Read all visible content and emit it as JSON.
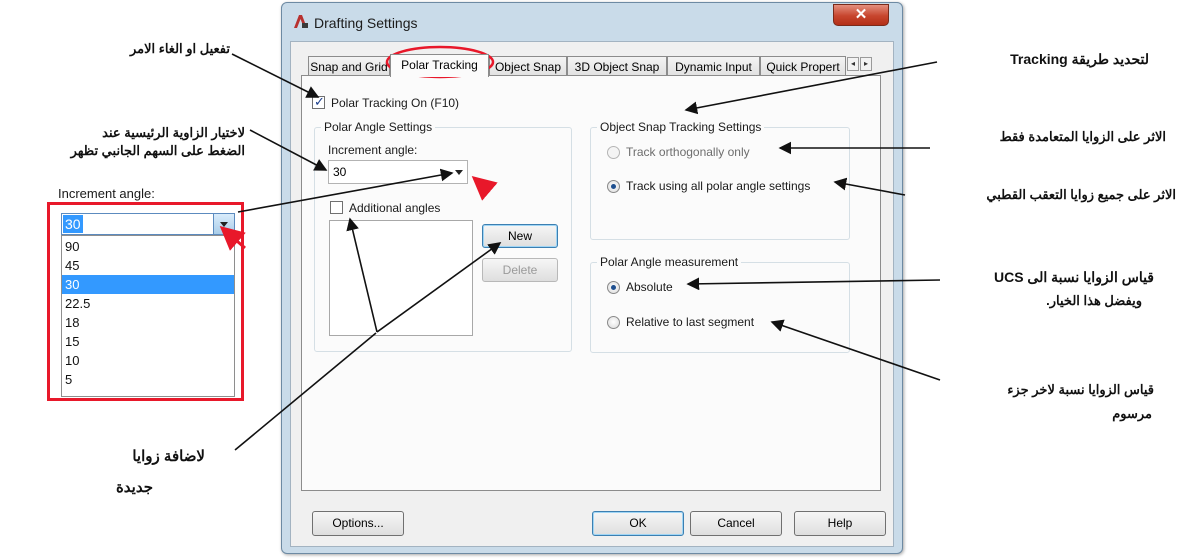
{
  "window": {
    "title": "Drafting Settings",
    "close_glyph": "✕"
  },
  "tabs": [
    {
      "label": "Snap and Grid"
    },
    {
      "label": "Polar Tracking"
    },
    {
      "label": "Object Snap"
    },
    {
      "label": "3D Object Snap"
    },
    {
      "label": "Dynamic Input"
    },
    {
      "label": "Quick Propert"
    }
  ],
  "tab_scroll": {
    "left": "◂",
    "right": "▸"
  },
  "polar_tracking_on": {
    "label": "Polar Tracking On (F10)",
    "checked": true
  },
  "polar_angle_settings": {
    "title": "Polar Angle Settings",
    "increment_label": "Increment angle:",
    "increment_value": "30",
    "additional_angles_label": "Additional angles",
    "additional_checked": false,
    "new_button": "New",
    "delete_button": "Delete"
  },
  "object_snap_tracking": {
    "title": "Object Snap Tracking Settings",
    "options": [
      {
        "label": "Track orthogonally only",
        "selected": false
      },
      {
        "label": "Track using all polar angle settings",
        "selected": true
      }
    ]
  },
  "polar_angle_measurement": {
    "title": "Polar Angle measurement",
    "options": [
      {
        "label": "Absolute",
        "selected": true
      },
      {
        "label": "Relative to last segment",
        "selected": false
      }
    ]
  },
  "footer": {
    "options": "Options...",
    "ok": "OK",
    "cancel": "Cancel",
    "help": "Help"
  },
  "increment_dropdown": {
    "caption": "Increment angle:",
    "selected": "30",
    "items": [
      "90",
      "45",
      "30",
      "22.5",
      "18",
      "15",
      "10",
      "5"
    ],
    "highlighted": "30"
  },
  "annotations": {
    "toggle": "تفعيل او الغاء الامر",
    "choose_angle_line1": "لاختيار الزاوية الرئيسية عند",
    "choose_angle_line2": "الضغط على السهم الجانبي تظهر",
    "add_angles_line1": "لاضافة زوايا",
    "add_angles_line2": "جديدة",
    "tracking_method": "لتحديد طريقة Tracking",
    "ortho_only": "الاثر على الزوايا المتعامدة فقط",
    "all_polar": "الاثر على جميع زوايا التعقب القطبي",
    "absolute_line1": "قياس الزوايا نسبة الى UCS",
    "absolute_line2": "ويفضل هذا الخيار.",
    "relative_line1": "قياس الزوايا نسبة لاخر جزء",
    "relative_line2": "مرسوم"
  },
  "colors": {
    "highlight_red": "#e8182a",
    "selection_blue": "#3399ff",
    "frame": "#c9dbe9"
  }
}
